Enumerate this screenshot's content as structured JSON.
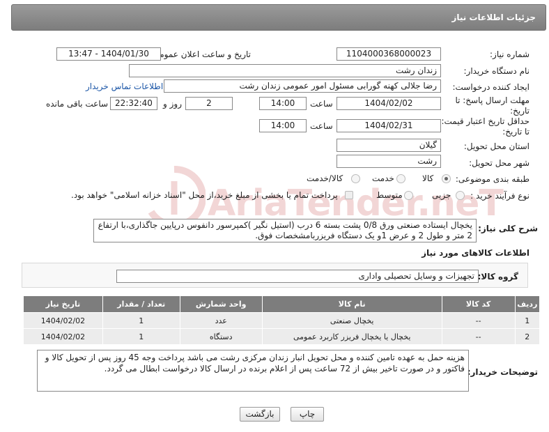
{
  "header": {
    "title": "جزئیات اطلاعات نیاز"
  },
  "watermark": {
    "text": "AriaTender.neT"
  },
  "form": {
    "need_number": {
      "label": "شماره نیاز:",
      "value": "1104000368000023"
    },
    "announce_datetime": {
      "label": "تاریخ و ساعت اعلان عمومی:",
      "value": "1404/01/30 - 13:47"
    },
    "buyer_org": {
      "label": "نام دستگاه خریدار:",
      "value": "زندان رشت"
    },
    "requester": {
      "label": "ایجاد کننده درخواست:",
      "value": "رضا جلالی کهنه گورابی مسئول امور عمومی زندان رشت",
      "contact_link": "اطلاعات تماس خریدار"
    },
    "reply_deadline": {
      "label_line1": "مهلت ارسال پاسخ: تا",
      "label_line2": "تاریخ:",
      "date": "1404/02/02",
      "time_label": "ساعت",
      "time": "14:00",
      "days": "2",
      "days_label": "روز و",
      "remaining": "22:32:40",
      "remaining_label": "ساعت باقی مانده"
    },
    "price_validity": {
      "label_line1": "حداقل تاریخ اعتبار قیمت:",
      "label_line2": "تا تاریخ:",
      "date": "1404/02/31",
      "time_label": "ساعت",
      "time": "14:00"
    },
    "delivery_province": {
      "label": "استان محل تحویل:",
      "value": "گیلان"
    },
    "delivery_city": {
      "label": "شهر محل تحویل:",
      "value": "رشت"
    },
    "category": {
      "label": "طبقه بندی موضوعی:",
      "options": [
        "کالا",
        "خدمت",
        "کالا/خدمت"
      ],
      "selected": "کالا"
    },
    "purchase_type": {
      "label": "نوع فرآیند خرید :",
      "options": [
        "جزیی",
        "متوسط"
      ],
      "selected": "",
      "payment_note": "پرداخت تمام یا بخشی از مبلغ خرید،از محل \"اسناد خزانه اسلامی\" خواهد بود."
    },
    "summary": {
      "label": "شرح کلی نیاز:",
      "value": "یخچال ایستاده صنعتی ورق 0/8 پشت بسته 6 درب (استیل نگیر )کمپرسور دانفوس درپایین جاگذاری،با ارتفاع 2 متر و طول 2 و عرض 1و یک دستگاه فریزربامشخصات فوق."
    }
  },
  "goods_section": {
    "title": "اطلاعات کالاهای مورد نیاز",
    "group_label": "گروه کالا:",
    "group_value": "تجهیزات و وسایل تحصیلی واداری",
    "columns": [
      "ردیف",
      "کد کالا",
      "نام کالا",
      "واحد شمارش",
      "تعداد / مقدار",
      "تاریخ نیاز"
    ],
    "rows": [
      [
        "1",
        "--",
        "یخچال صنعتی",
        "عدد",
        "1",
        "1404/02/02"
      ],
      [
        "2",
        "--",
        "یخچال یا یخچال فریزر کاربرد عمومی",
        "دستگاه",
        "1",
        "1404/02/02"
      ]
    ]
  },
  "buyer_notes": {
    "label": "توضیحات خریدار:",
    "value": "هزینه حمل به عهده تامین کننده و محل تحویل انبار زندان مرکزی رشت می باشد پرداخت وجه 45 روز پس از تحویل کالا و فاکتور و در صورت تاخیر بیش از 72 ساعت پس از اعلام برنده در ارسال کالا درخواست ابطال می گردد."
  },
  "buttons": {
    "print": "چاپ",
    "back": "بازگشت"
  },
  "colors": {
    "header_bg": "#8a8a8a",
    "table_header_bg": "#7d7d7d",
    "table_row_bg": "#ececec",
    "link": "#1a55a6",
    "watermark": "#f2d6d6"
  }
}
